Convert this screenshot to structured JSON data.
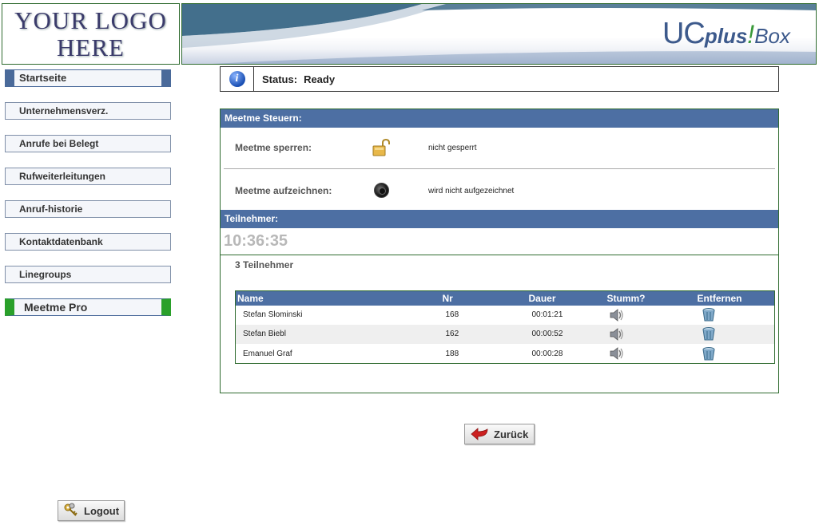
{
  "header": {
    "logo_line1": "YOUR LOGO",
    "logo_line2": "HERE",
    "brand_uc": "UC",
    "brand_plus": "plus",
    "brand_bang": "!",
    "brand_box": "Box"
  },
  "sidebar": {
    "items": [
      {
        "label": "Startseite"
      },
      {
        "label": "Unternehmensverz."
      },
      {
        "label": "Anrufe bei Belegt"
      },
      {
        "label": "Rufweiterleitungen"
      },
      {
        "label": "Anruf-historie"
      },
      {
        "label": "Kontaktdatenbank"
      },
      {
        "label": "Linegroups"
      },
      {
        "label": "Meetme Pro"
      }
    ]
  },
  "status": {
    "label": "Status:",
    "value": "Ready",
    "icon": "info-icon"
  },
  "meetme": {
    "header": "Meetme Steuern:",
    "lock_label": "Meetme sperren:",
    "lock_value": "nicht gesperrt",
    "record_label": "Meetme aufzeichnen:",
    "record_value": "wird nicht aufgezeichnet"
  },
  "participants": {
    "header": "Teilnehmer:",
    "timer": "10:36:35",
    "count_label": "3 Teilnehmer",
    "columns": [
      "Name",
      "Nr",
      "Dauer",
      "Stumm?",
      "Entfernen"
    ],
    "rows": [
      {
        "name": "Stefan Slominski",
        "nr": "168",
        "dauer": "00:01:21"
      },
      {
        "name": "Stefan Biebl",
        "nr": "162",
        "dauer": "00:00:52"
      },
      {
        "name": "Emanuel Graf",
        "nr": "188",
        "dauer": "00:00:28"
      }
    ]
  },
  "buttons": {
    "back_label": "Zurück",
    "logout_label": "Logout"
  },
  "colors": {
    "header_blue": "#4d6fa3",
    "border_green": "#2f6b2f",
    "active_green": "#2aa02a"
  }
}
